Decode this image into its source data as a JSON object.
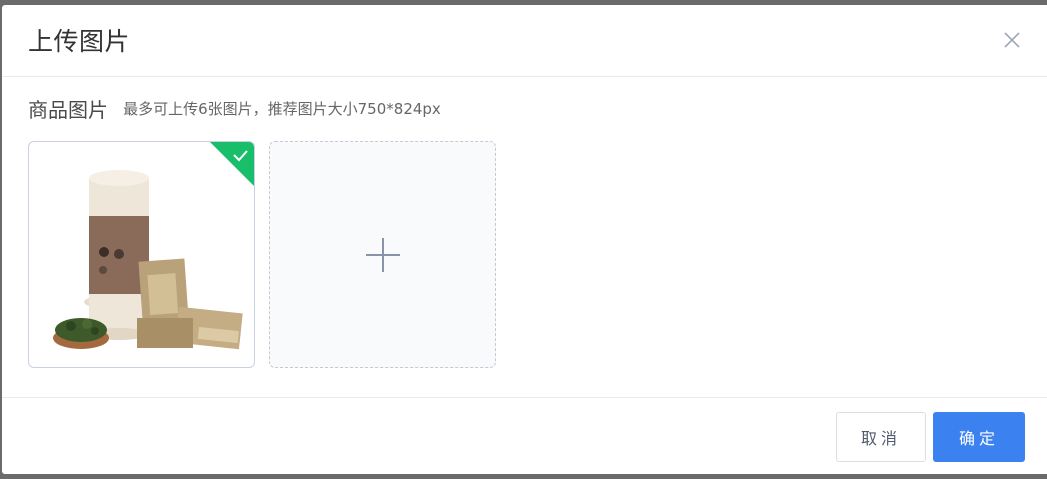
{
  "dialog": {
    "title": "上传图片",
    "close_icon": "close-icon"
  },
  "section": {
    "label": "商品图片",
    "hint": "最多可上传6张图片，推荐图片大小750*824px"
  },
  "uploaded_images": [
    {
      "subject": "tea canister product photo",
      "selected": true,
      "badge_icon": "check-icon"
    }
  ],
  "uploader": {
    "icon": "plus-icon"
  },
  "footer": {
    "cancel_label": "取消",
    "ok_label": "确定"
  },
  "colors": {
    "primary": "#3b82f0",
    "success_badge": "#19be6b",
    "border": "#dcdee2"
  }
}
